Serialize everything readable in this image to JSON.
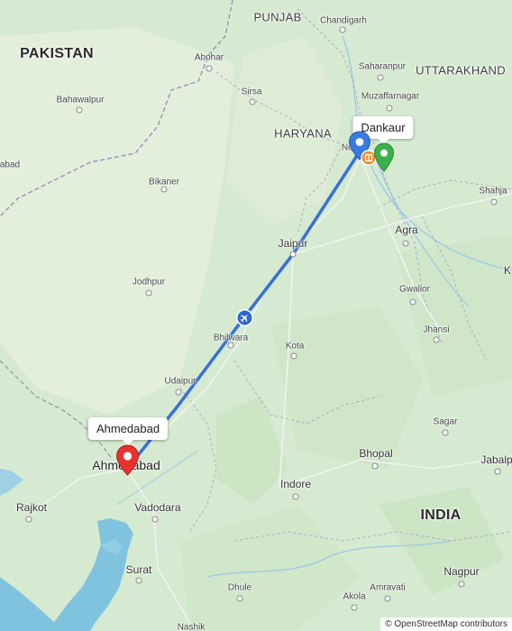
{
  "map": {
    "labels": {
      "pakistan": "PAKISTAN",
      "punjab": "PUNJAB",
      "haryana": "HARYANA",
      "uttarakhand": "UTTARAKHAND",
      "india": "INDIA",
      "chandigarh": "Chandigarh",
      "abohar": "Abohar",
      "saharanpur": "Saharanpur",
      "bahawalpur": "Bahawalpur",
      "sirsa": "Sirsa",
      "muzaffarnagar": "Muzaffarnagar",
      "noida": "Noida",
      "abad": "abad",
      "bikaner": "Bikaner",
      "shahjahanpur": "Shahja",
      "agra": "Agra",
      "jaipur": "Jaipur",
      "k_partial": "K",
      "jodhpur": "Jodhpur",
      "gwalior": "Gwalior",
      "bhilwara": "Bhilwara",
      "jhansi": "Jhansi",
      "kota": "Kota",
      "udaipur": "Udaipur",
      "sagar": "Sagar",
      "ahmedabad": "Ahmedabad",
      "bhopal": "Bhopal",
      "jabalpur": "Jabalp",
      "rajkot": "Rajkot",
      "indore": "Indore",
      "vadodara": "Vadodara",
      "surat": "Surat",
      "nagpur": "Nagpur",
      "amravati": "Amravati",
      "dhule": "Dhule",
      "akola": "Akola",
      "nashik": "Nashik"
    },
    "callouts": {
      "origin": "Dankaur",
      "destination": "Ahmedabad"
    },
    "markers": {
      "origin_color": "#3a7be0",
      "destination_color": "#e8322f",
      "poi_color": "#3cb04a",
      "amenity_color": "#f08a24",
      "route_color": "#3a6fd8"
    },
    "attribution": "© OpenStreetMap contributors"
  }
}
